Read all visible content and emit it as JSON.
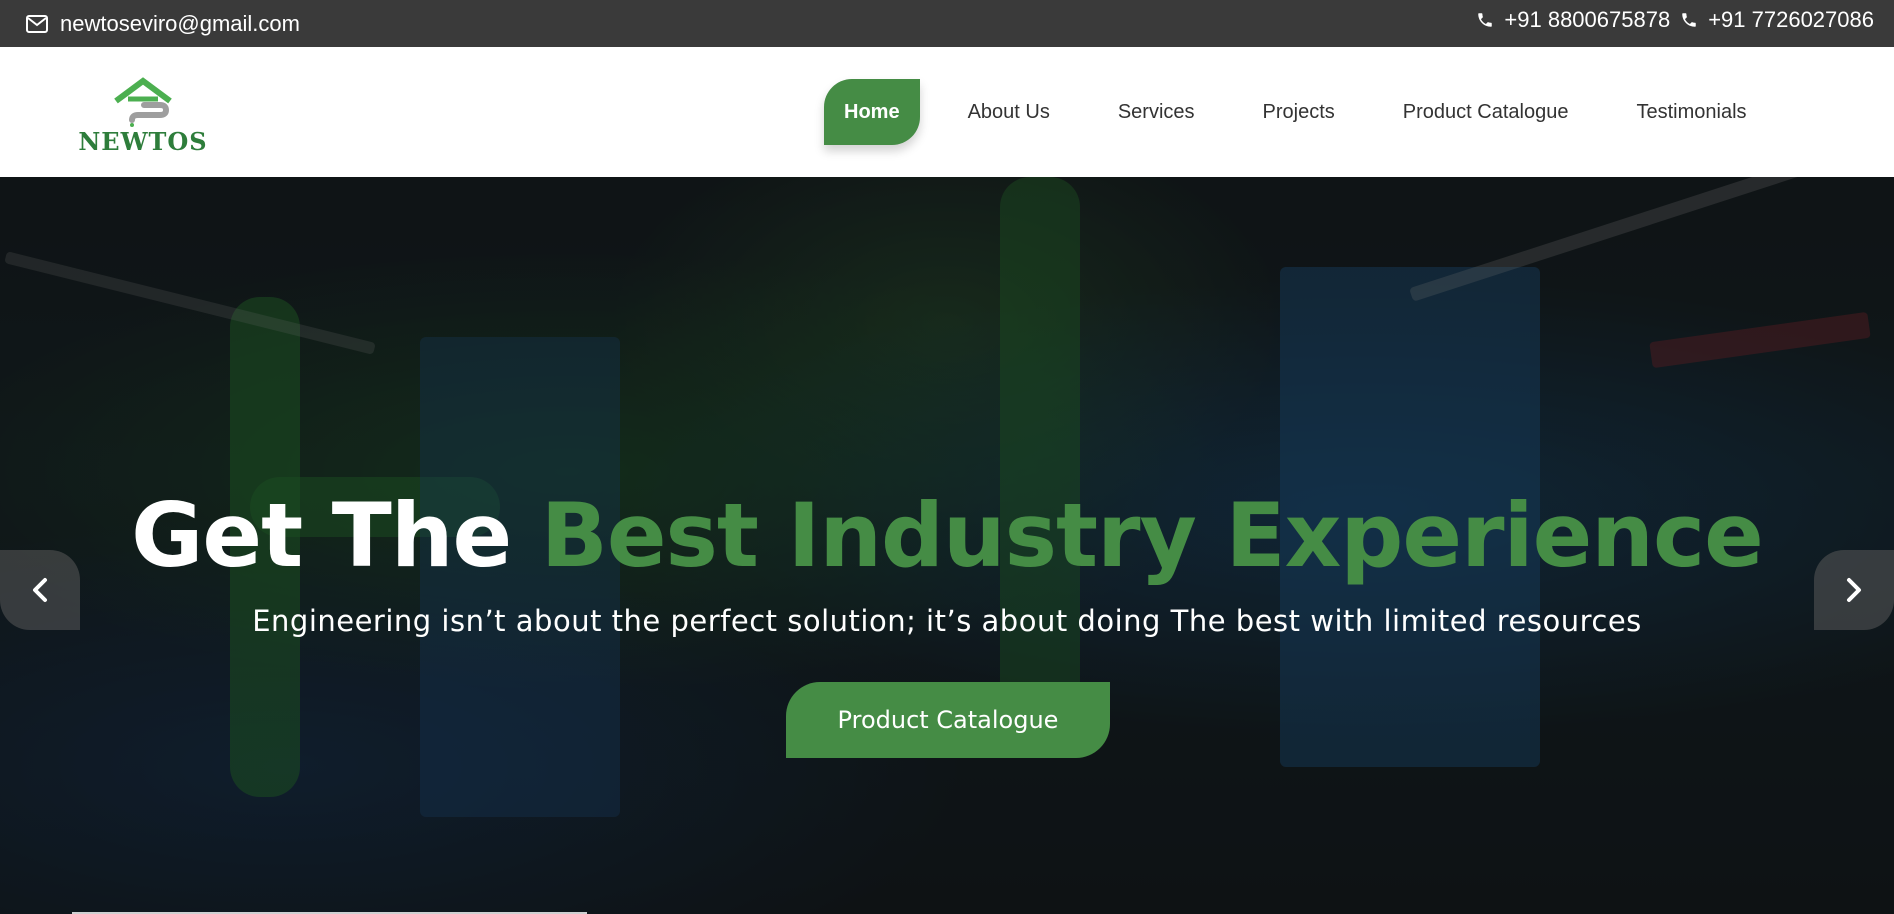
{
  "topbar": {
    "email": "newtoseviro@gmail.com",
    "phone1": "+91 8800675878",
    "phone2": "+91 7726027086",
    "icons": {
      "email": "envelope-icon",
      "phone": "phone-icon"
    }
  },
  "logo": {
    "text": "NEWTOS"
  },
  "nav": {
    "items": [
      {
        "label": "Home",
        "active": true
      },
      {
        "label": "About Us"
      },
      {
        "label": "Services"
      },
      {
        "label": "Projects"
      },
      {
        "label": "Product Catalogue"
      },
      {
        "label": "Testimonials"
      }
    ]
  },
  "hero": {
    "title_white": "Get The ",
    "title_green": "Best Industry Experience",
    "subtitle": "Engineering isn’t about the perfect solution; it’s about doing The best with limited resources",
    "button_label": "Product Catalogue",
    "icons": {
      "prev": "chevron-left-icon",
      "next": "chevron-right-icon"
    }
  },
  "colors": {
    "brand_green": "#458c45",
    "topbar_bg": "#3a3a3a",
    "text_dark": "#333333"
  }
}
